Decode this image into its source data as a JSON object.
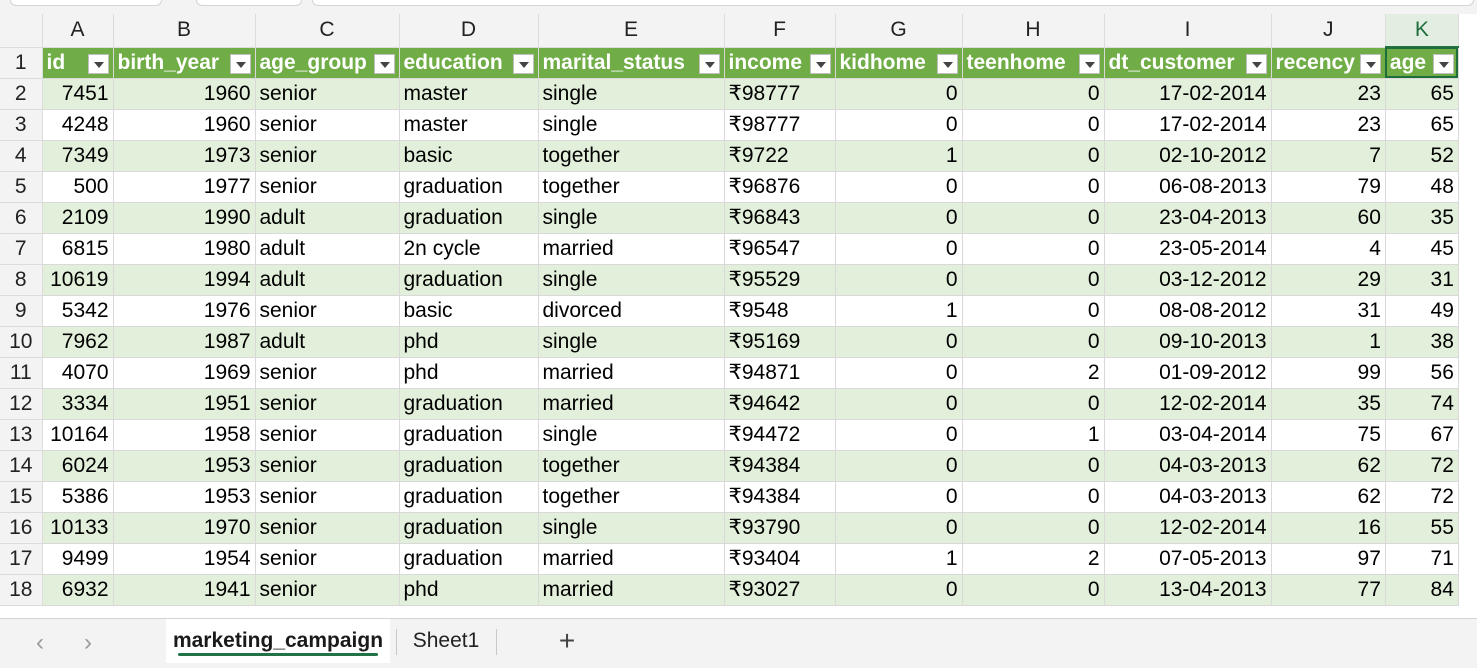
{
  "columns": [
    "A",
    "B",
    "C",
    "D",
    "E",
    "F",
    "G",
    "H",
    "I",
    "J",
    "K"
  ],
  "active_column": "K",
  "headers": [
    "id",
    "birth_year",
    "age_group",
    "education",
    "marital_status",
    "income",
    "kidhome",
    "teenhome",
    "dt_customer",
    "recency",
    "age"
  ],
  "row_numbers": [
    "1",
    "2",
    "3",
    "4",
    "5",
    "6",
    "7",
    "8",
    "9",
    "10",
    "11",
    "12",
    "13",
    "14",
    "15",
    "16",
    "17",
    "18"
  ],
  "rows": [
    [
      "7451",
      "1960",
      "senior",
      "master",
      "single",
      "₹98777",
      "0",
      "0",
      "17-02-2014",
      "23",
      "65"
    ],
    [
      "4248",
      "1960",
      "senior",
      "master",
      "single",
      "₹98777",
      "0",
      "0",
      "17-02-2014",
      "23",
      "65"
    ],
    [
      "7349",
      "1973",
      "senior",
      "basic",
      "together",
      "₹9722",
      "1",
      "0",
      "02-10-2012",
      "7",
      "52"
    ],
    [
      "500",
      "1977",
      "senior",
      "graduation",
      "together",
      "₹96876",
      "0",
      "0",
      "06-08-2013",
      "79",
      "48"
    ],
    [
      "2109",
      "1990",
      "adult",
      "graduation",
      "single",
      "₹96843",
      "0",
      "0",
      "23-04-2013",
      "60",
      "35"
    ],
    [
      "6815",
      "1980",
      "adult",
      "2n cycle",
      "married",
      "₹96547",
      "0",
      "0",
      "23-05-2014",
      "4",
      "45"
    ],
    [
      "10619",
      "1994",
      "adult",
      "graduation",
      "single",
      "₹95529",
      "0",
      "0",
      "03-12-2012",
      "29",
      "31"
    ],
    [
      "5342",
      "1976",
      "senior",
      "basic",
      "divorced",
      "₹9548",
      "1",
      "0",
      "08-08-2012",
      "31",
      "49"
    ],
    [
      "7962",
      "1987",
      "adult",
      "phd",
      "single",
      "₹95169",
      "0",
      "0",
      "09-10-2013",
      "1",
      "38"
    ],
    [
      "4070",
      "1969",
      "senior",
      "phd",
      "married",
      "₹94871",
      "0",
      "2",
      "01-09-2012",
      "99",
      "56"
    ],
    [
      "3334",
      "1951",
      "senior",
      "graduation",
      "married",
      "₹94642",
      "0",
      "0",
      "12-02-2014",
      "35",
      "74"
    ],
    [
      "10164",
      "1958",
      "senior",
      "graduation",
      "single",
      "₹94472",
      "0",
      "1",
      "03-04-2014",
      "75",
      "67"
    ],
    [
      "6024",
      "1953",
      "senior",
      "graduation",
      "together",
      "₹94384",
      "0",
      "0",
      "04-03-2013",
      "62",
      "72"
    ],
    [
      "5386",
      "1953",
      "senior",
      "graduation",
      "together",
      "₹94384",
      "0",
      "0",
      "04-03-2013",
      "62",
      "72"
    ],
    [
      "10133",
      "1970",
      "senior",
      "graduation",
      "single",
      "₹93790",
      "0",
      "0",
      "12-02-2014",
      "16",
      "55"
    ],
    [
      "9499",
      "1954",
      "senior",
      "graduation",
      "married",
      "₹93404",
      "1",
      "2",
      "07-05-2013",
      "97",
      "71"
    ],
    [
      "6932",
      "1941",
      "senior",
      "phd",
      "married",
      "₹93027",
      "0",
      "0",
      "13-04-2013",
      "77",
      "84"
    ]
  ],
  "sheet_tabs": [
    "marketing_campaign",
    "Sheet1"
  ],
  "active_tab": "marketing_campaign",
  "nav": {
    "prev_icon": "‹",
    "next_icon": "›",
    "add_icon": "+"
  },
  "colors": {
    "header_fill": "#70ad47",
    "band_fill": "#e2efda",
    "accent": "#217346"
  }
}
